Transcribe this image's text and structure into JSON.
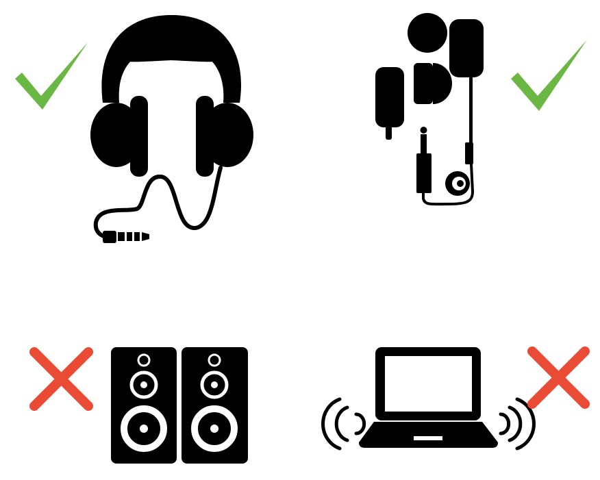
{
  "colors": {
    "allowed": "#6ab843",
    "not_allowed": "#e94b35",
    "icon": "#000000",
    "background": "#ffffff"
  },
  "items": [
    {
      "icon": "over-ear-headphones-icon",
      "status": "allowed",
      "status_icon": "checkmark-icon"
    },
    {
      "icon": "earbuds-icon",
      "status": "allowed",
      "status_icon": "checkmark-icon"
    },
    {
      "icon": "speakers-icon",
      "status": "not_allowed",
      "status_icon": "cross-icon"
    },
    {
      "icon": "laptop-speakers-icon",
      "status": "not_allowed",
      "status_icon": "cross-icon"
    }
  ]
}
